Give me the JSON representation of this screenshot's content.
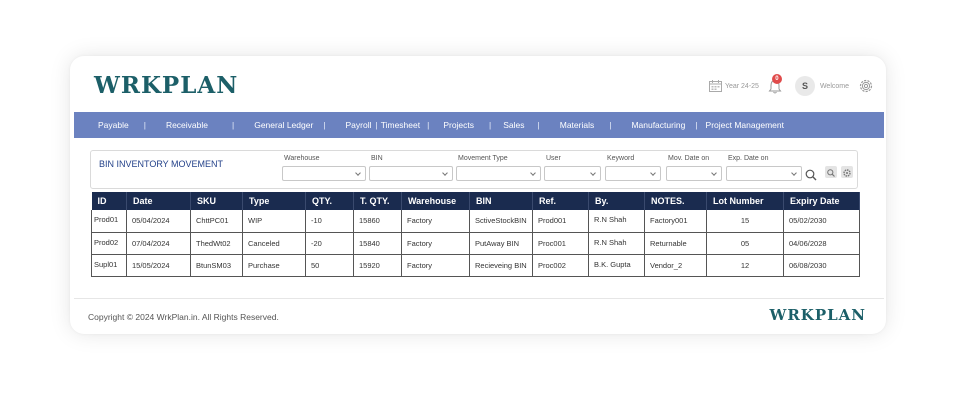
{
  "brand": {
    "name": "WRKPLAN"
  },
  "header": {
    "year_label": "Year 24-25",
    "notification_count": "0",
    "avatar_initial": "S",
    "welcome_label": "Welcome"
  },
  "nav": {
    "items": [
      "Payable",
      "Receivable",
      "General Ledger",
      "Payroll",
      "Timesheet",
      "Projects",
      "Sales",
      "Materials",
      "Manufacturing",
      "Project Management"
    ],
    "separator": "|"
  },
  "filter": {
    "title": "BIN INVENTORY MOVEMENT",
    "fields": [
      {
        "label": "Warehouse",
        "value": ""
      },
      {
        "label": "BIN",
        "value": ""
      },
      {
        "label": "Movement Type",
        "value": ""
      },
      {
        "label": "User",
        "value": ""
      },
      {
        "label": "Keyword",
        "value": ""
      },
      {
        "label": "Mov. Date on",
        "value": ""
      },
      {
        "label": "Exp. Date on",
        "value": ""
      }
    ]
  },
  "table": {
    "columns": [
      "ID",
      "Date",
      "SKU",
      "Type",
      "QTY.",
      "T. QTY.",
      "Warehouse",
      "BIN",
      "Ref.",
      "By.",
      "NOTES.",
      "Lot Number",
      "Expiry Date"
    ],
    "rows": [
      [
        "Prod01",
        "05/04/2024",
        "ChttPC01",
        "WIP",
        "-10",
        "15860",
        "Factory",
        "SctiveStockBIN",
        "Prod001",
        "R.N Shah",
        "Factory001",
        "15",
        "05/02/2030"
      ],
      [
        "Prod02",
        "07/04/2024",
        "ThedWt02",
        "Canceled",
        "-20",
        "15840",
        "Factory",
        "PutAway BIN",
        "Proc001",
        "R.N Shah",
        "Returnable",
        "05",
        "04/06/2028"
      ],
      [
        "Supl01",
        "15/05/2024",
        "BtunSM03",
        "Purchase",
        "50",
        "15920",
        "Factory",
        "Recieveing BIN",
        "Proc002",
        "B.K. Gupta",
        "Vendor_2",
        "12",
        "06/08/2030"
      ]
    ]
  },
  "footer": {
    "copyright": "Copyright © 2024 WrkPlan.in. All Rights Reserved.",
    "brand": "WRKPLAN"
  },
  "colors": {
    "nav_bg": "#6b82c0",
    "table_header_bg": "#1a2b4f",
    "brand": "#1c5f68",
    "badge": "#e04b4b"
  },
  "icons": [
    "calendar-icon",
    "bell-icon",
    "gear-icon",
    "search-icon",
    "zoom-icon",
    "settings-icon",
    "chevron-down-icon"
  ]
}
